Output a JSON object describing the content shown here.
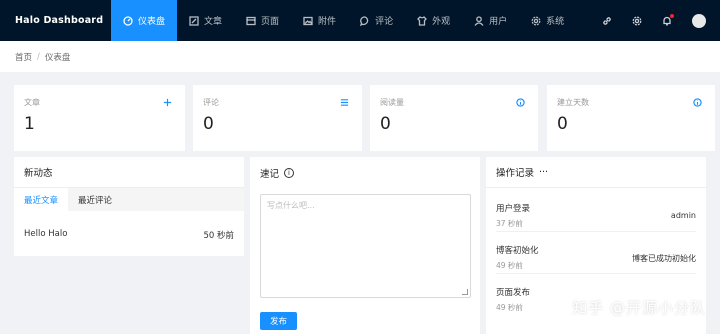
{
  "brand": "Halo  Dashboard",
  "nav": [
    {
      "label": "仪表盘",
      "icon": "dashboard-icon"
    },
    {
      "label": "文章",
      "icon": "form-icon"
    },
    {
      "label": "页面",
      "icon": "page-icon"
    },
    {
      "label": "附件",
      "icon": "picture-icon"
    },
    {
      "label": "评论",
      "icon": "message-icon"
    },
    {
      "label": "外观",
      "icon": "skin-icon"
    },
    {
      "label": "用户",
      "icon": "user-icon"
    },
    {
      "label": "系统",
      "icon": "setting-icon"
    }
  ],
  "breadcrumb": {
    "home": "首页",
    "sep": "/",
    "current": "仪表盘"
  },
  "stats": [
    {
      "label": "文章",
      "value": "1",
      "icon": "plus-icon"
    },
    {
      "label": "评论",
      "value": "0",
      "icon": "menu-icon"
    },
    {
      "label": "阅读量",
      "value": "0",
      "icon": "info-icon"
    },
    {
      "label": "建立天数",
      "value": "0",
      "icon": "info-icon"
    }
  ],
  "activity": {
    "title": "新动态",
    "tabs": [
      "最近文章",
      "最近评论"
    ],
    "posts": [
      {
        "title": "Hello Halo",
        "time": "50 秒前"
      }
    ]
  },
  "journal": {
    "title": "速记",
    "placeholder": "写点什么吧...",
    "button": "发布"
  },
  "logs": {
    "title": "操作记录",
    "more": "···",
    "items": [
      {
        "title": "用户登录",
        "time": "37 秒前",
        "detail": "admin"
      },
      {
        "title": "博客初始化",
        "time": "49 秒前",
        "detail": "博客已成功初始化"
      },
      {
        "title": "页面发布",
        "time": "49 秒前",
        "detail": ""
      }
    ]
  },
  "watermark": "知乎 @开源小分队",
  "colors": {
    "topbar": "#001529",
    "accent": "#1890ff",
    "background": "#f0f2f5"
  }
}
